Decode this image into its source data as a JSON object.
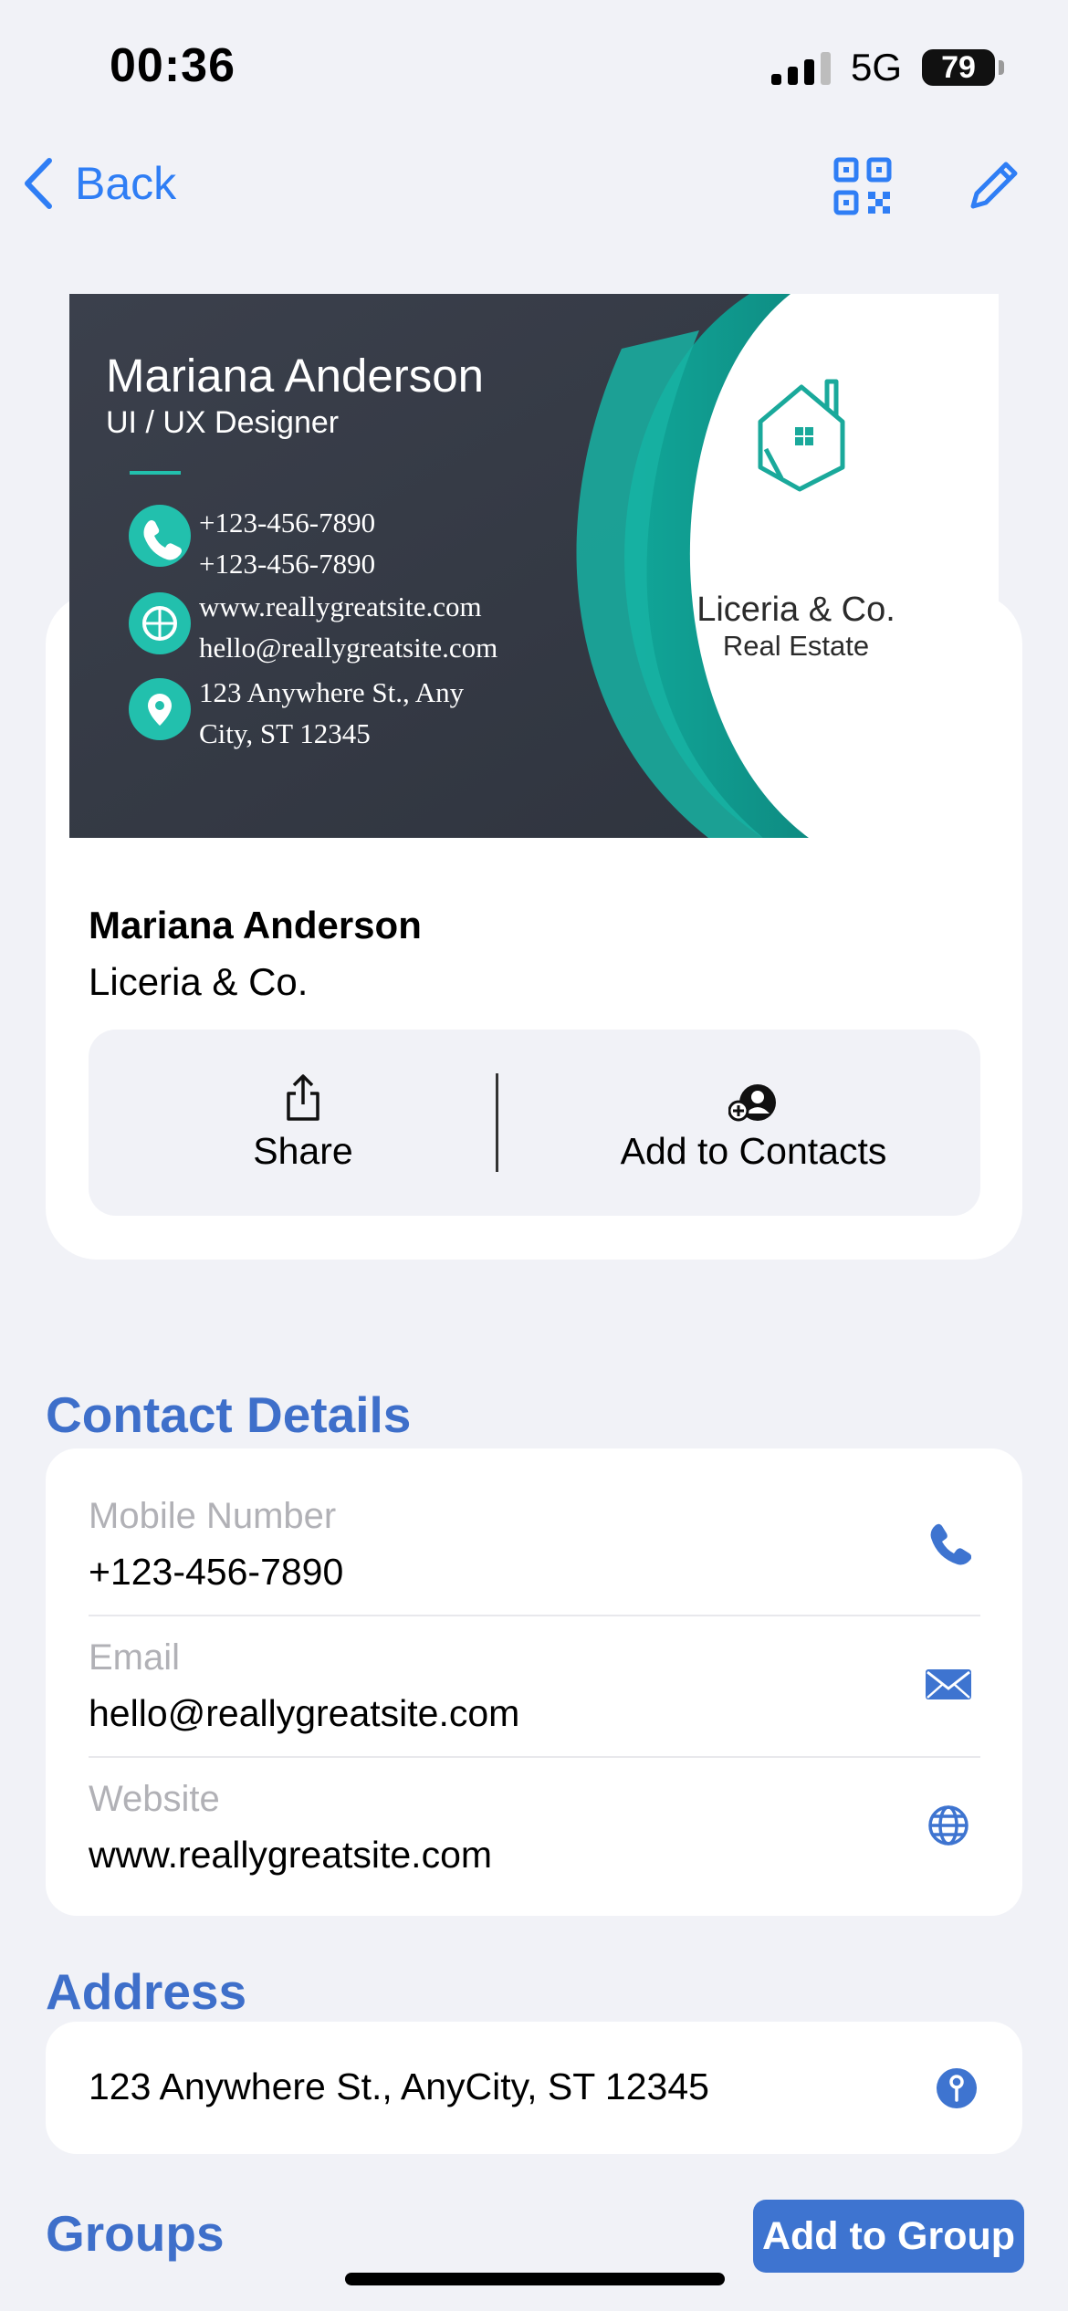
{
  "status_bar": {
    "time": "00:36",
    "network": "5G",
    "battery": "79"
  },
  "nav": {
    "back_label": "Back"
  },
  "business_card": {
    "name": "Mariana Anderson",
    "title": "UI / UX Designer",
    "phone_1": "+123-456-7890",
    "phone_2": "+123-456-7890",
    "website": "www.reallygreatsite.com",
    "email": "hello@reallygreatsite.com",
    "address_line_1": "123 Anywhere St., Any",
    "address_line_2": "City, ST 12345",
    "company": "Liceria & Co.",
    "company_tagline": "Real Estate",
    "colors": {
      "dark": "#3a3f4a",
      "teal": "#1fb5a8"
    }
  },
  "contact": {
    "name": "Mariana Anderson",
    "company": "Liceria & Co.",
    "share_label": "Share",
    "add_contacts_label": "Add to Contacts"
  },
  "contact_details": {
    "heading": "Contact Details",
    "items": [
      {
        "label": "Mobile Number",
        "value": "+123-456-7890",
        "icon": "phone-icon"
      },
      {
        "label": "Email",
        "value": "hello@reallygreatsite.com",
        "icon": "mail-icon"
      },
      {
        "label": "Website",
        "value": "www.reallygreatsite.com",
        "icon": "globe-icon"
      }
    ]
  },
  "address": {
    "heading": "Address",
    "value": "123 Anywhere St., AnyCity, ST 12345",
    "icon": "map-pin-icon"
  },
  "groups": {
    "heading": "Groups",
    "add_label": "Add to Group"
  },
  "colors": {
    "accent": "#2f7ef5",
    "section_blue": "#3e6fca",
    "button_blue": "#3e74d0"
  }
}
